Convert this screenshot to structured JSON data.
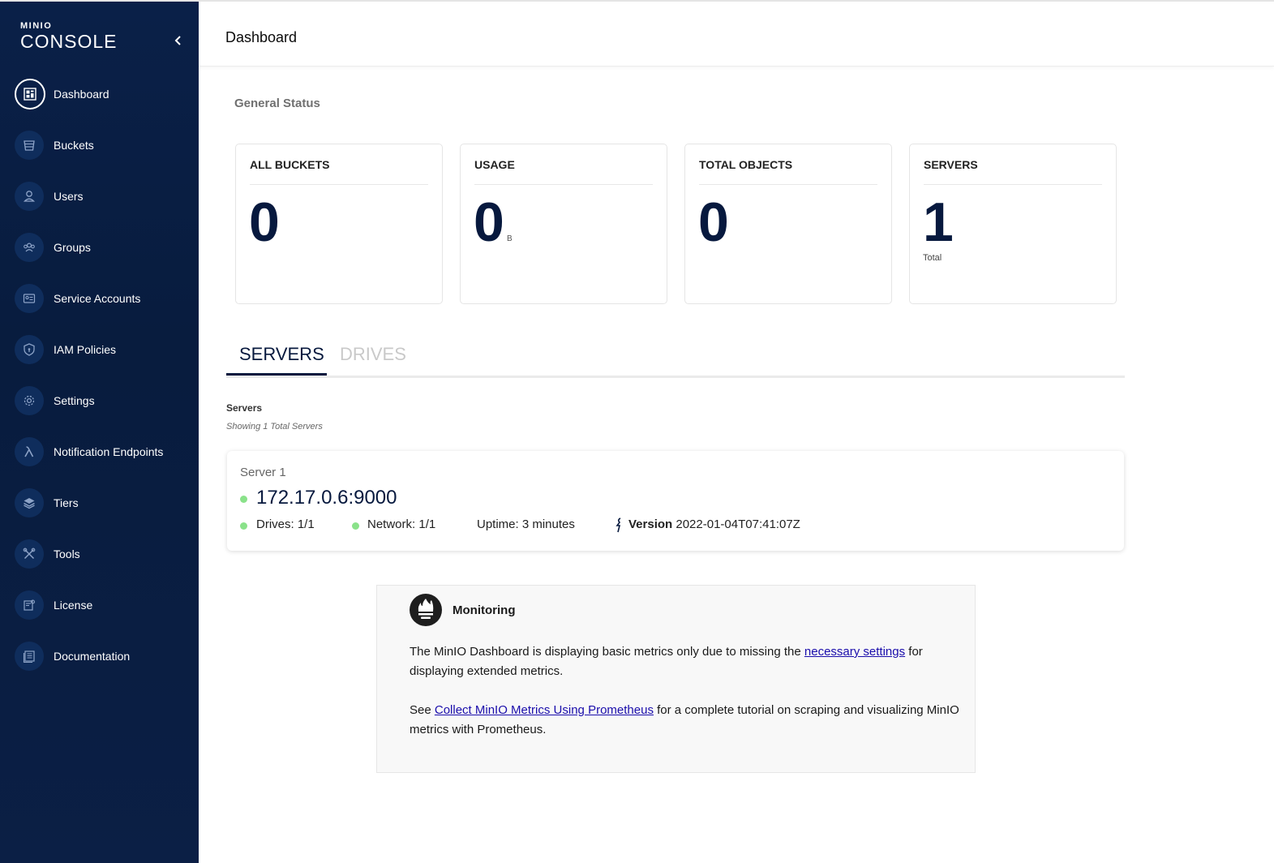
{
  "sidebar": {
    "brand": "MINIO",
    "product": "CONSOLE",
    "items": [
      {
        "label": "Dashboard",
        "icon": "dashboard-icon"
      },
      {
        "label": "Buckets",
        "icon": "bucket-icon"
      },
      {
        "label": "Users",
        "icon": "user-icon"
      },
      {
        "label": "Groups",
        "icon": "groups-icon"
      },
      {
        "label": "Service Accounts",
        "icon": "service-accounts-icon"
      },
      {
        "label": "IAM Policies",
        "icon": "shield-icon"
      },
      {
        "label": "Settings",
        "icon": "gear-icon"
      },
      {
        "label": "Notification Endpoints",
        "icon": "lambda-icon"
      },
      {
        "label": "Tiers",
        "icon": "layers-icon"
      },
      {
        "label": "Tools",
        "icon": "tools-icon"
      },
      {
        "label": "License",
        "icon": "license-icon"
      },
      {
        "label": "Documentation",
        "icon": "documentation-icon"
      }
    ]
  },
  "header": {
    "title": "Dashboard"
  },
  "main": {
    "section_title": "General Status",
    "cards": [
      {
        "label": "ALL BUCKETS",
        "value": "0"
      },
      {
        "label": "USAGE",
        "value": "0",
        "unit": "B"
      },
      {
        "label": "TOTAL OBJECTS",
        "value": "0"
      },
      {
        "label": "SERVERS",
        "value": "1",
        "sub": "Total"
      }
    ],
    "tabs": [
      {
        "label": "SERVERS",
        "active": true
      },
      {
        "label": "DRIVES",
        "active": false
      }
    ],
    "servers_label": "Servers",
    "servers_count": "Showing 1 Total Servers",
    "server": {
      "name": "Server 1",
      "address": "172.17.0.6:9000",
      "drives": "Drives: 1/1",
      "network": "Network: 1/1",
      "uptime": "Uptime: 3 minutes",
      "version_label": "Version",
      "version": "2022-01-04T07:41:07Z"
    },
    "monitoring": {
      "title": "Monitoring",
      "p1_before": "The MinIO Dashboard is displaying basic metrics only due to missing the ",
      "p1_link": "necessary settings",
      "p1_after": " for displaying extended metrics.",
      "p2_before": "See ",
      "p2_link": "Collect MinIO Metrics Using Prometheus",
      "p2_after": " for a complete tutorial on scraping and visualizing MinIO metrics with Prometheus."
    }
  },
  "colors": {
    "sidebar_bg": "#0a2048",
    "accent": "#07193e",
    "status_ok": "#8ae28a",
    "link": "#1a0dab"
  }
}
